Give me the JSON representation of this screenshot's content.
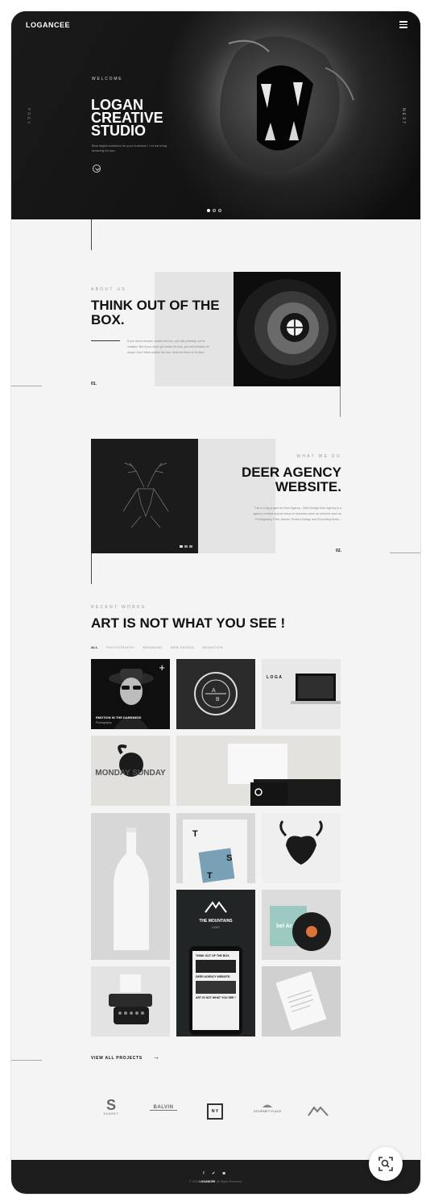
{
  "header": {
    "logo": "LOGANCEE",
    "menu_icon": "hamburger-icon"
  },
  "hero": {
    "welcome": "WELCOME",
    "title": "LOGAN CREATIVE STUDIO",
    "subtitle": "Best digital solutions for your business ! Let we bring amazing for you.",
    "prev": "PREV",
    "next": "NEXT",
    "scroll_icon": "chevron-down-circle-icon",
    "slides": 3,
    "active_slide": 1
  },
  "about": {
    "label": "ABOUT US",
    "title": "THINK OUT OF THE BOX.",
    "text": "If you never venture outside the box, you will probably not be creative. But if you never get inside the box, you will certainly be stupid. Don't think outside the box, think the there is No Box!",
    "number": "01."
  },
  "what_we_do": {
    "label": "WHAT WE DO",
    "title": "DEER AGENCY WEBSITE.",
    "text": "This is a big project for Deer Agency - Web Design Deer Agency is a agency creative and art focus on business some art services such as : Photography, Print, Interior, Product Design and Recording Music...",
    "number": "02."
  },
  "recent_works": {
    "label": "RECENT WORKS",
    "title": "ART IS NOT WHAT YOU SEE !",
    "filters": [
      "ALL",
      "PHOTOGRAPHY",
      "BRANDING",
      "WEB DESIGN",
      "ANIMATION"
    ],
    "active_filter": "ALL",
    "tile1_title": "EMOTION IN THE DARKNESS",
    "tile1_sub": "Photography",
    "tile3_word": "LOGA",
    "tile4_text": "MONDAY SUNDAY",
    "tile7_letters": [
      "T",
      "S",
      "T"
    ],
    "tile9_title": "THE MOUNTAINS",
    "tile9_sub": "GORT",
    "phone_line1": "THINK OUT OF THE BOX.",
    "phone_line2": "DEER AGENCY WEBSITE.",
    "phone_line3": "ART IS NOT WHAT YOU SEE !",
    "tile10_text": "bel Ar",
    "view_all": "VIEW ALL PROJECTS",
    "view_all_icon": "arrow-right-icon"
  },
  "clients": {
    "sunset_big": "S",
    "sunset_small": "SUNSET",
    "balvin": "BALVIN",
    "ny": "N Y",
    "gourmet": "GOURMET PLACE"
  },
  "footer": {
    "social": "f ✔ ◙",
    "copy_prefix": "© 2015",
    "brand": "LOGANCEE",
    "copy_suffix": ". All Rights Reserved."
  },
  "colors": {
    "hero_bg": "#141414",
    "page_bg": "#f4f4f4",
    "accent_dark": "#111111",
    "footer_bg": "#1d1d1d"
  }
}
